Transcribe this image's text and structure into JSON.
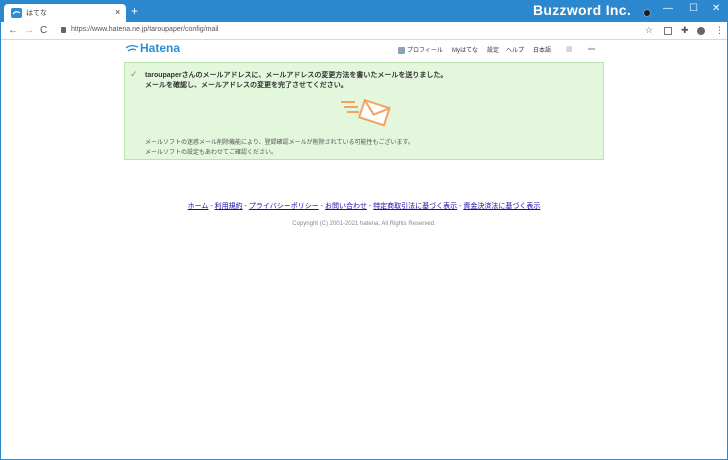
{
  "browser": {
    "tab_title": "はてな",
    "tab_close": "×",
    "new_tab": "+",
    "overlay_brand": "Buzzword Inc.",
    "window_controls": {
      "minimize": "—",
      "maximize": "☐",
      "close": "✕"
    },
    "nav": {
      "back": "←",
      "forward": "→",
      "reload": "C"
    },
    "url": "https://www.hatena.ne.jp/taroupaper/config/mail",
    "toolbar_icons": {
      "star": "☆",
      "extension": "✚",
      "menu": "⋮"
    },
    "accent_color": "#2b87ce"
  },
  "header": {
    "logo_text": "Hatena",
    "nav_items": [
      "プロフィール",
      "Myはてな",
      "設定",
      "ヘルプ",
      "日本語"
    ]
  },
  "notice": {
    "username": "taroupaper",
    "line1_rest": "さんのメールアドレスに、メールアドレスの変更方法を書いたメールを送りました。",
    "line2": "メールを確認し、メールアドレスの変更を完了させてください。",
    "note1": "メールソフトの迷惑メール削除機能により、登録確認メールが削除されている可能性もございます。",
    "note2": "メールソフトの設定もあわせてご確認ください。",
    "bg_color": "#e2f7dc",
    "art_color": "#f4a261"
  },
  "footer": {
    "links": [
      "ホーム",
      "利用規約",
      "プライバシーポリシー",
      "お問い合わせ",
      "特定商取引法に基づく表示",
      "資金決済法に基づく表示"
    ],
    "separator": " - ",
    "copyright": "Copyright (C) 2001-2021 hatena. All Rights Reserved."
  }
}
